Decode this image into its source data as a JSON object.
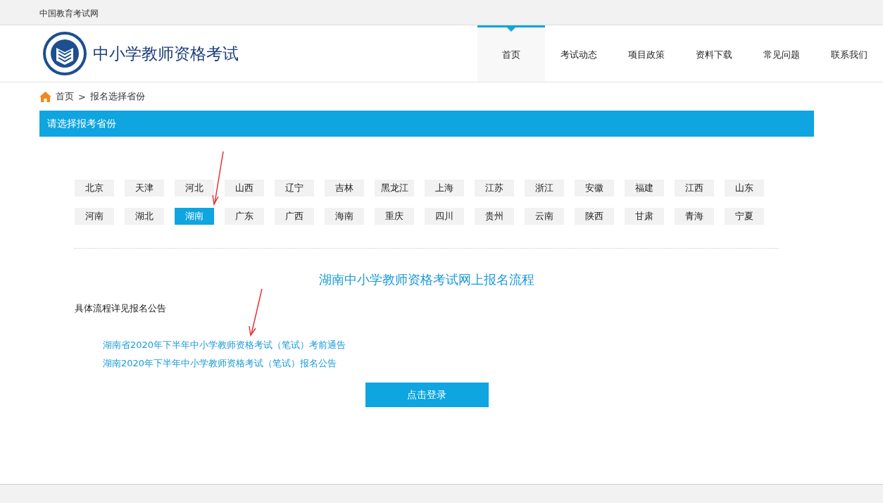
{
  "top_bar": {
    "site_name": "中国教育考试网"
  },
  "header": {
    "title": "中小学教师资格考试"
  },
  "nav": [
    {
      "label": "首页",
      "selected": true
    },
    {
      "label": "考试动态",
      "selected": false
    },
    {
      "label": "项目政策",
      "selected": false
    },
    {
      "label": "资料下载",
      "selected": false
    },
    {
      "label": "常见问题",
      "selected": false
    },
    {
      "label": "联系我们",
      "selected": false
    }
  ],
  "breadcrumb": [
    "首页",
    ">",
    "报名选择省份"
  ],
  "panel_title": "请选择报考省份",
  "provinces": [
    {
      "label": "北京",
      "selected": false
    },
    {
      "label": "天津",
      "selected": false
    },
    {
      "label": "河北",
      "selected": false
    },
    {
      "label": "山西",
      "selected": false
    },
    {
      "label": "辽宁",
      "selected": false
    },
    {
      "label": "吉林",
      "selected": false
    },
    {
      "label": "黑龙江",
      "selected": false
    },
    {
      "label": "上海",
      "selected": false
    },
    {
      "label": "江苏",
      "selected": false
    },
    {
      "label": "浙江",
      "selected": false
    },
    {
      "label": "安徽",
      "selected": false
    },
    {
      "label": "福建",
      "selected": false
    },
    {
      "label": "江西",
      "selected": false
    },
    {
      "label": "山东",
      "selected": false
    },
    {
      "label": "河南",
      "selected": false
    },
    {
      "label": "湖北",
      "selected": false
    },
    {
      "label": "湖南",
      "selected": true
    },
    {
      "label": "广东",
      "selected": false
    },
    {
      "label": "广西",
      "selected": false
    },
    {
      "label": "海南",
      "selected": false
    },
    {
      "label": "重庆",
      "selected": false
    },
    {
      "label": "四川",
      "selected": false
    },
    {
      "label": "贵州",
      "selected": false
    },
    {
      "label": "云南",
      "selected": false
    },
    {
      "label": "陕西",
      "selected": false
    },
    {
      "label": "甘肃",
      "selected": false
    },
    {
      "label": "青海",
      "selected": false
    },
    {
      "label": "宁夏",
      "selected": false
    }
  ],
  "process_title": "湖南中小学教师资格考试网上报名流程",
  "note": "具体流程详见报名公告",
  "links": [
    "湖南省2020年下半年中小学教师资格考试（笔试）考前通告",
    "湖南2020年下半年中小学教师资格考试（笔试）报名公告"
  ],
  "login_button": "点击登录"
}
